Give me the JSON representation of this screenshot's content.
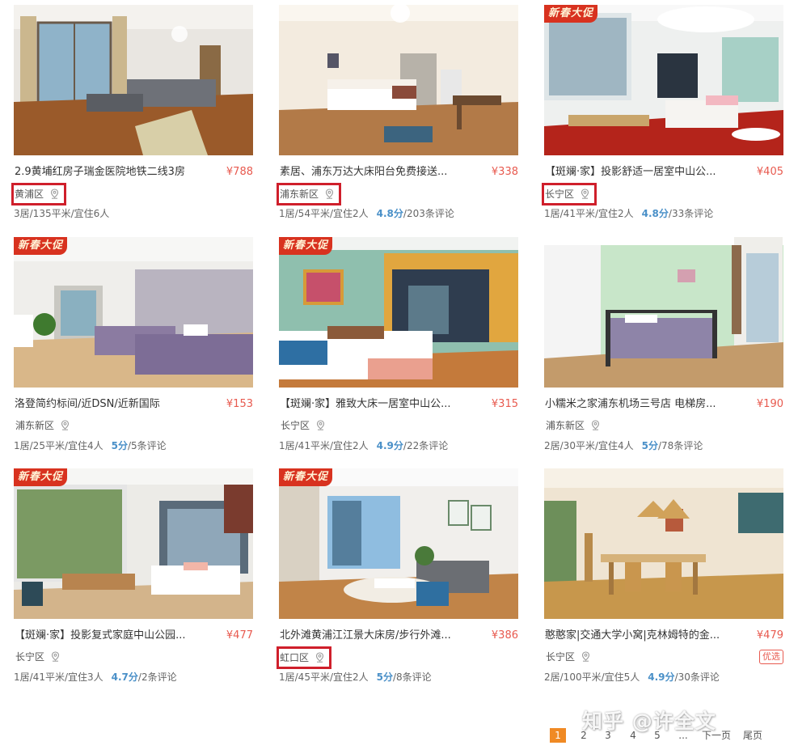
{
  "listings": [
    {
      "title": "2.9黄埔红房子瑞金医院地铁二线3房",
      "price": "¥788",
      "district": "黄浦区",
      "district_highlighted": true,
      "promo": "",
      "rooms": "3居/135平米/宜住6人",
      "score": "",
      "reviews": "",
      "tag": ""
    },
    {
      "title": "素居、浦东万达大床阳台免费接送...",
      "price": "¥338",
      "district": "浦东新区",
      "district_highlighted": true,
      "promo": "",
      "rooms": "1居/54平米/宜住2人",
      "score": "4.8分",
      "reviews": "/203条评论",
      "tag": ""
    },
    {
      "title": "【斑斓·家】投影舒适一居室中山公...",
      "price": "¥405",
      "district": "长宁区",
      "district_highlighted": true,
      "promo": "新春大促",
      "rooms": "1居/41平米/宜住2人",
      "score": "4.8分",
      "reviews": "/33条评论",
      "tag": ""
    },
    {
      "title": "洛登简约标间/近DSN/近新国际",
      "price": "¥153",
      "district": "浦东新区",
      "district_highlighted": false,
      "promo": "新春大促",
      "rooms": "1居/25平米/宜住4人",
      "score": "5分",
      "reviews": "/5条评论",
      "tag": ""
    },
    {
      "title": "【斑斓·家】雅致大床一居室中山公...",
      "price": "¥315",
      "district": "长宁区",
      "district_highlighted": false,
      "promo": "新春大促",
      "rooms": "1居/41平米/宜住2人",
      "score": "4.9分",
      "reviews": "/22条评论",
      "tag": ""
    },
    {
      "title": "小糯米之家浦东机场三号店 电梯房...",
      "price": "¥190",
      "district": "浦东新区",
      "district_highlighted": false,
      "promo": "",
      "rooms": "2居/30平米/宜住4人",
      "score": "5分",
      "reviews": "/78条评论",
      "tag": ""
    },
    {
      "title": "【斑斓·家】投影复式家庭中山公园...",
      "price": "¥477",
      "district": "长宁区",
      "district_highlighted": false,
      "promo": "新春大促",
      "rooms": "1居/41平米/宜住3人",
      "score": "4.7分",
      "reviews": "/2条评论",
      "tag": ""
    },
    {
      "title": "北外滩黄浦江江景大床房/步行外滩...",
      "price": "¥386",
      "district": "虹口区",
      "district_highlighted": true,
      "promo": "新春大促",
      "rooms": "1居/45平米/宜住2人",
      "score": "5分",
      "reviews": "/8条评论",
      "tag": ""
    },
    {
      "title": "憨憨家|交通大学小窝|克林姆特的金...",
      "price": "¥479",
      "district": "长宁区",
      "district_highlighted": false,
      "promo": "",
      "rooms": "2居/100平米/宜住5人",
      "score": "4.9分",
      "reviews": "/30条评论",
      "tag": "优选"
    }
  ],
  "pagination": {
    "pages": [
      "1",
      "2",
      "3",
      "4",
      "5"
    ],
    "ellipsis": "...",
    "next": "下一页",
    "last": "尾页",
    "current": "1"
  },
  "watermark": "知乎 @许全文",
  "colors": {
    "price": "#e85a4f",
    "highlight_box": "#cf1f2b",
    "score": "#4a90c8",
    "pager_active": "#f08a24",
    "promo_badge": "#d8321f"
  },
  "icons": {
    "district": "map-pin-icon"
  }
}
